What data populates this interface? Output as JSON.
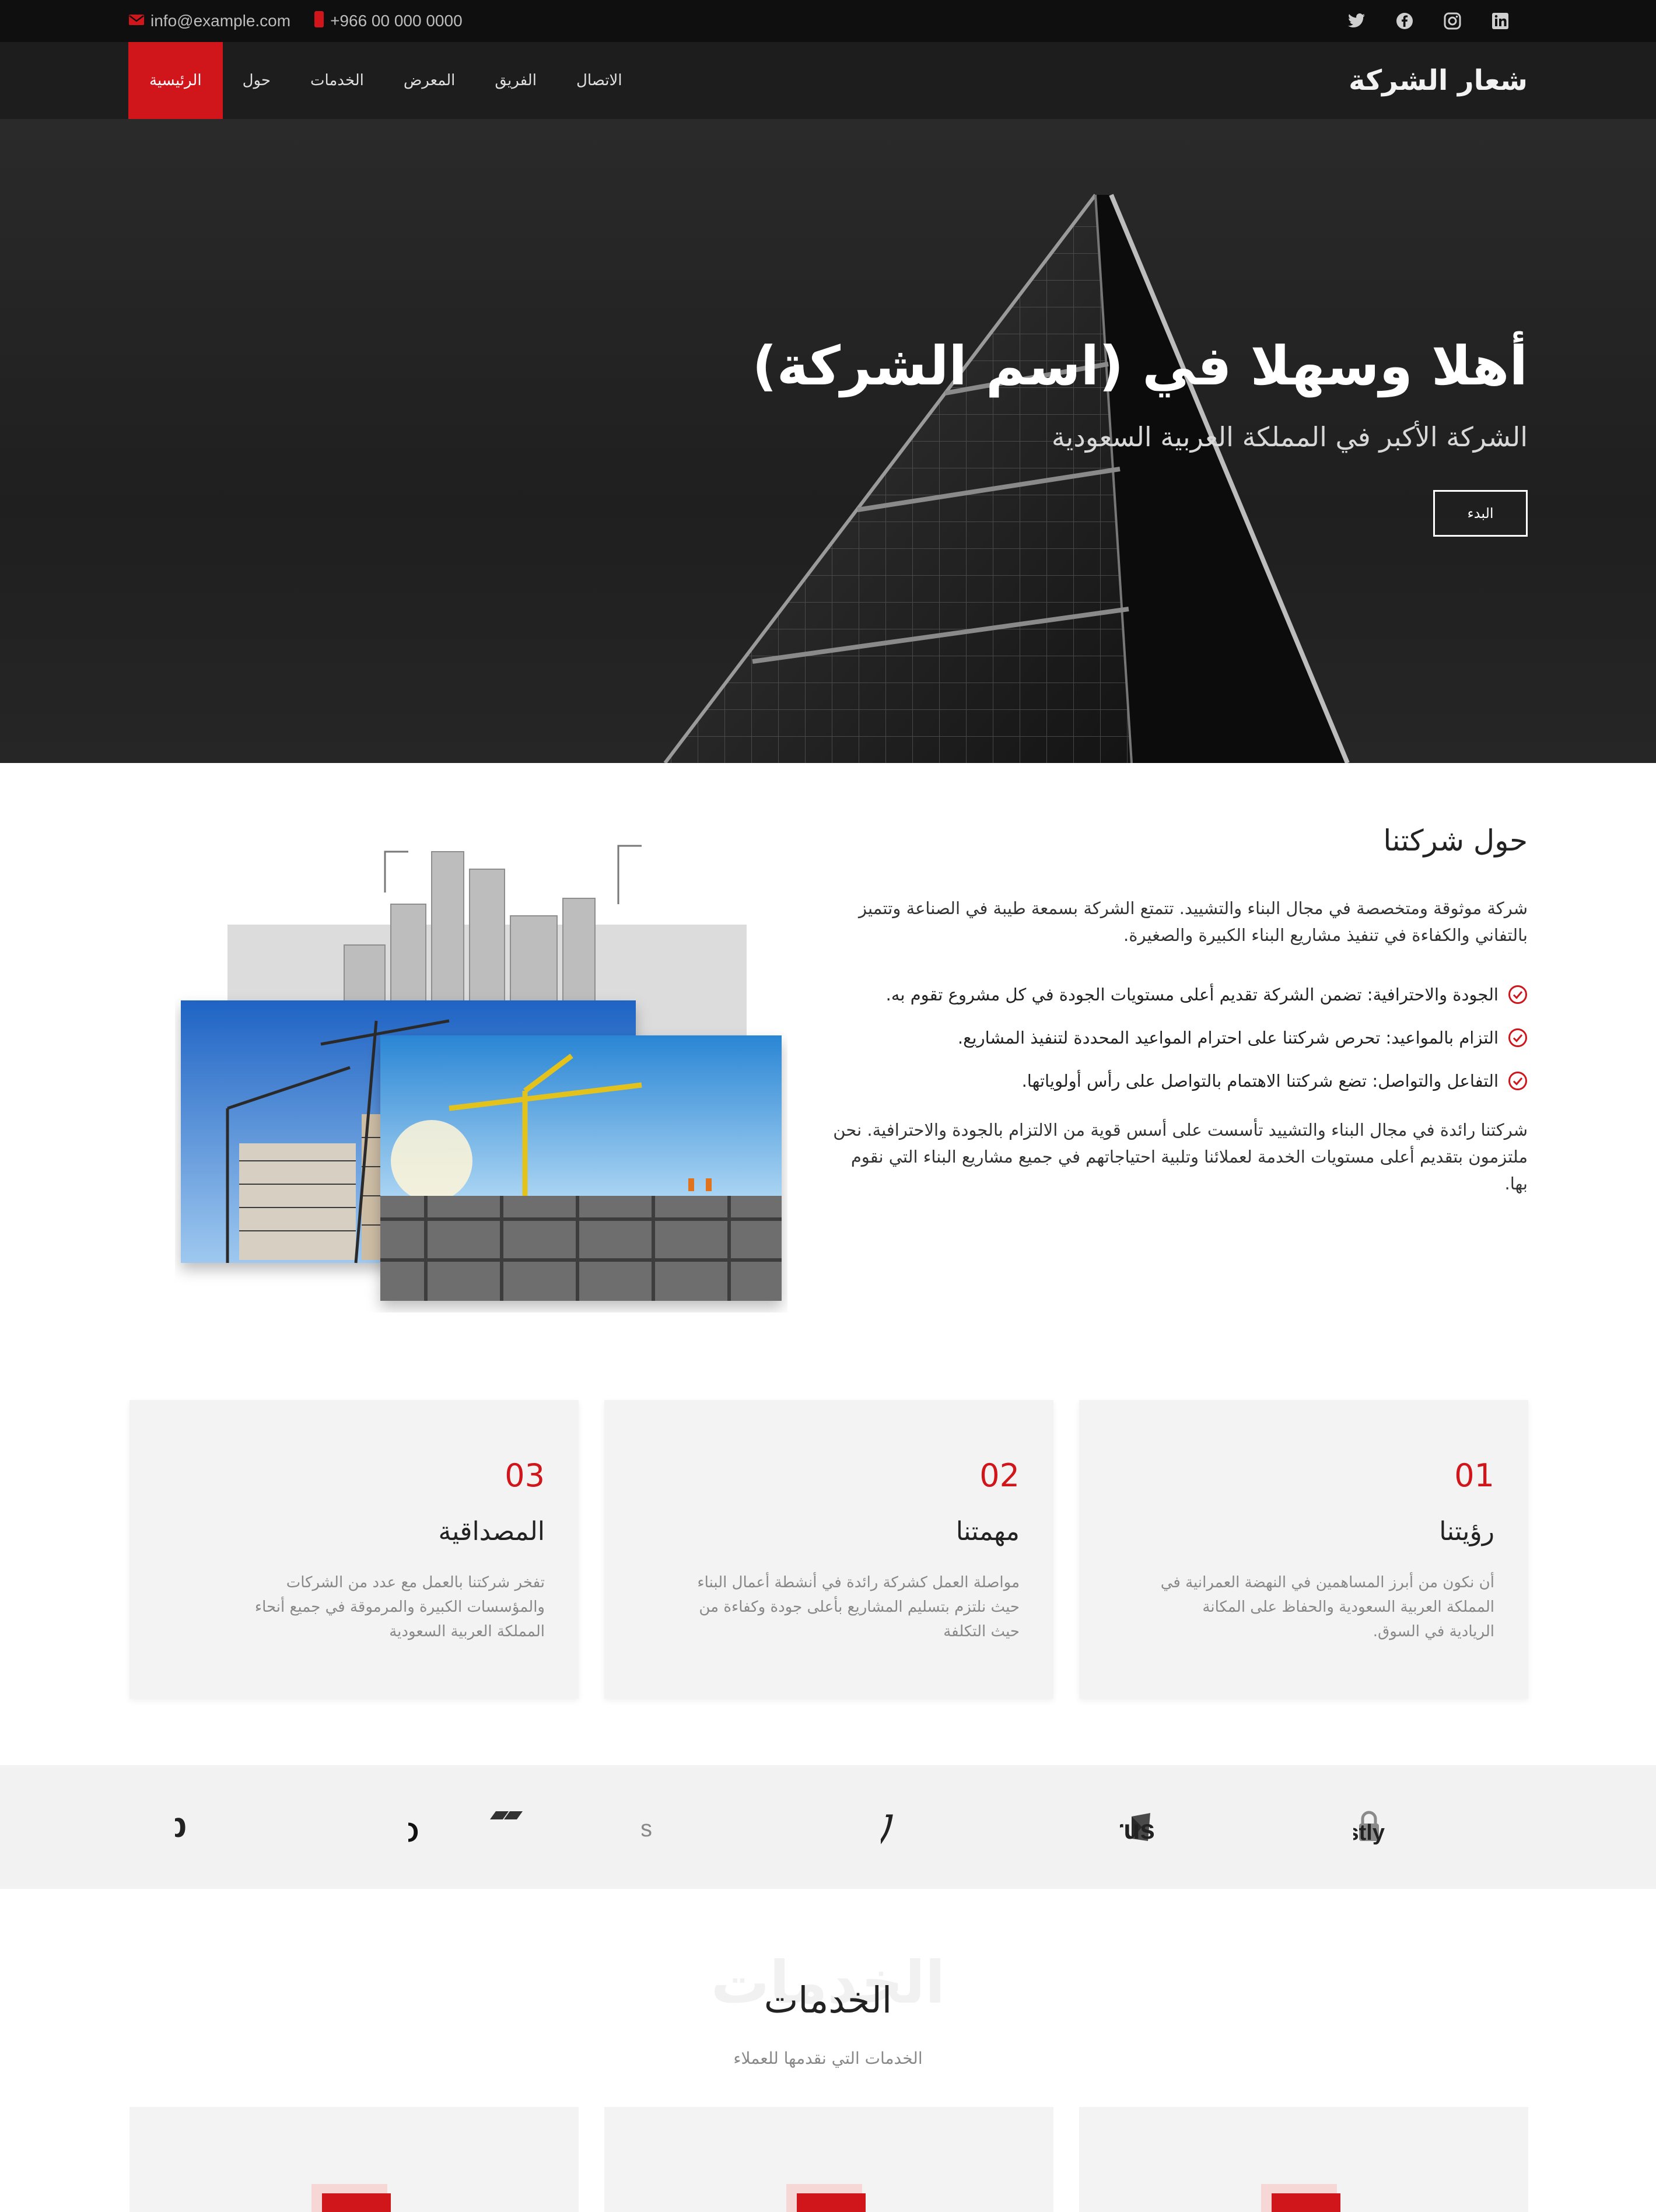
{
  "topbar": {
    "email": "info@example.com",
    "phone": "+966 00 000 0000",
    "email_icon": "envelope-icon",
    "phone_icon": "mobile-phone-icon",
    "social": [
      "twitter-icon",
      "facebook-icon",
      "instagram-icon",
      "linkedin-icon"
    ]
  },
  "navbar": {
    "logo": "شعار الشركة",
    "menu": [
      "الرئيسية",
      "حول",
      "الخدمات",
      "المعرض",
      "الفريق",
      "الاتصال"
    ],
    "active_index": 0
  },
  "hero": {
    "title": "أهلا وسهلا في (اسم الشركة)",
    "subtitle": "الشركة الأكبر في المملكة العربية السعودية",
    "button": "البدء"
  },
  "about": {
    "title": "حول شركتنا",
    "paragraph1": "شركة موثوقة ومتخصصة في مجال البناء والتشييد. تتمتع الشركة بسمعة طيبة في الصناعة وتتميز بالتفاني والكفاءة في تنفيذ مشاريع البناء الكبيرة والصغيرة.",
    "list": [
      "الجودة والاحترافية: تضمن الشركة تقديم أعلى مستويات الجودة في كل مشروع تقوم به.",
      "التزام بالمواعيد: تحرص شركتنا على احترام المواعيد المحددة لتنفيذ المشاريع.",
      "التفاعل والتواصل: تضع شركتنا الاهتمام بالتواصل على رأس أولوياتها."
    ],
    "paragraph2": "شركتنا رائدة في مجال البناء والتشييد تأسست على أسس قوية من الالتزام بالجودة والاحترافية. نحن ملتزمون بتقديم أعلى مستويات الخدمة لعملائنا وتلبية احتياجاتهم في جميع مشاريع البناء التي نقوم بها."
  },
  "features": [
    {
      "num": "01",
      "title": "رؤيتنا",
      "text": "أن نكون من أبرز المساهمين في النهضة العمرانية في المملكة العربية السعودية والحفاظ على المكانة الريادية في السوق."
    },
    {
      "num": "02",
      "title": "مهمتنا",
      "text": "مواصلة العمل كشركة رائدة في أنشطة أعمال البناء حيث نلتزم بتسليم المشاريع بأعلى جودة وكفاءة من حيث التكلفة"
    },
    {
      "num": "03",
      "title": "المصداقية",
      "text": "تفخر شركتنا بالعمل مع عدد من الشركات والمؤسسات الكبيرة والمرموقة في جميع أنحاء المملكة العربية السعودية"
    }
  ],
  "clients": [
    "Trustly",
    "citrus",
    "Lilly",
    "LifeGroups",
    "BELIMO",
    "myob"
  ],
  "services": {
    "watermark": "الخدمات",
    "title": "الخدمات",
    "subtitle": "الخدمات التي نقدمها للعملاء",
    "card_icon": "service-icon"
  },
  "colors": {
    "accent": "#d0151b",
    "topbar": "#0f0f0f",
    "navbar": "#1d1d1d",
    "card": "#f3f3f3"
  }
}
